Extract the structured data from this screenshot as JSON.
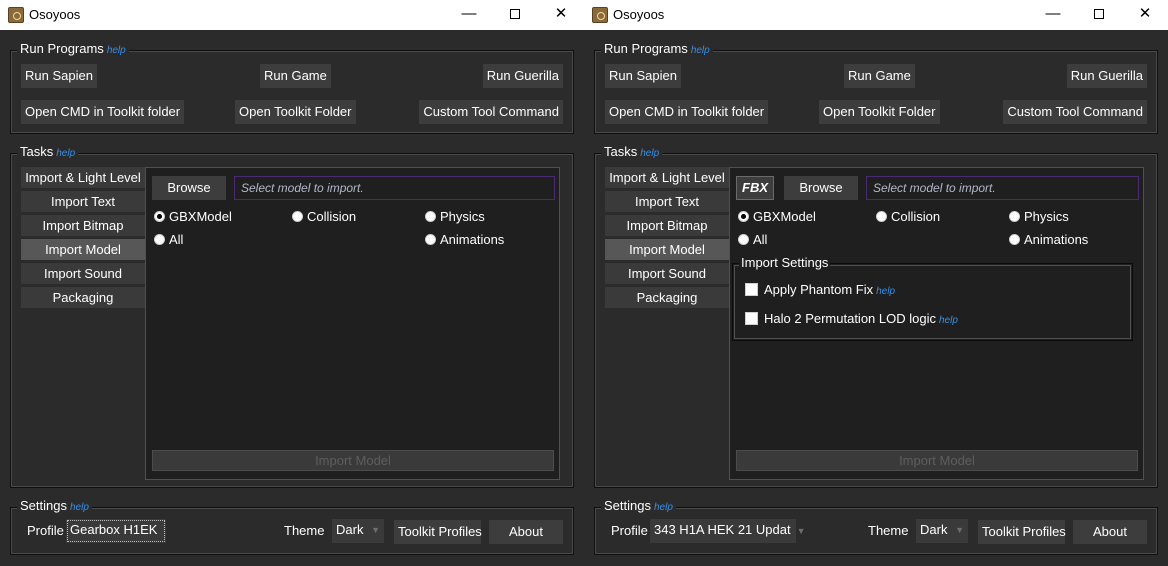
{
  "windows": [
    {
      "title": "Osoyoos",
      "run_programs": {
        "title": "Run Programs",
        "help": "help",
        "buttons": [
          "Run Sapien",
          "Run Game",
          "Run Guerilla",
          "Open CMD in Toolkit folder",
          "Open Toolkit Folder",
          "Custom Tool Command"
        ]
      },
      "tasks": {
        "title": "Tasks",
        "help": "help",
        "tabs": [
          "Import & Light Level",
          "Import Text",
          "Import Bitmap",
          "Import Model",
          "Import Sound",
          "Packaging"
        ],
        "active_tab": "Import Model",
        "browse_label": "Browse",
        "path_placeholder": "Select model to import.",
        "radios": [
          "GBXModel",
          "Collision",
          "Physics",
          "All",
          "Animations"
        ],
        "selected_radio": "GBXModel",
        "import_button": "Import Model"
      },
      "settings": {
        "title": "Settings",
        "help": "help",
        "profile_label": "Profile",
        "profile_value": "Gearbox H1EK",
        "theme_label": "Theme",
        "theme_value": "Dark",
        "toolkit_profiles_label": "Toolkit Profiles",
        "about_label": "About"
      }
    },
    {
      "title": "Osoyoos",
      "run_programs": {
        "title": "Run Programs",
        "help": "help",
        "buttons": [
          "Run Sapien",
          "Run Game",
          "Run Guerilla",
          "Open CMD in Toolkit folder",
          "Open Toolkit Folder",
          "Custom Tool Command"
        ]
      },
      "tasks": {
        "title": "Tasks",
        "help": "help",
        "tabs": [
          "Import & Light Level",
          "Import Text",
          "Import Bitmap",
          "Import Model",
          "Import Sound",
          "Packaging"
        ],
        "active_tab": "Import Model",
        "fbx_label": "FBX",
        "browse_label": "Browse",
        "path_placeholder": "Select model to import.",
        "radios": [
          "GBXModel",
          "Collision",
          "Physics",
          "All",
          "Animations"
        ],
        "selected_radio": "GBXModel",
        "import_settings": {
          "title": "Import Settings",
          "options": [
            {
              "label": "Apply Phantom Fix",
              "help": "help",
              "checked": false
            },
            {
              "label": "Halo 2 Permutation LOD logic",
              "help": "help",
              "checked": false
            }
          ]
        },
        "import_button": "Import Model"
      },
      "settings": {
        "title": "Settings",
        "help": "help",
        "profile_label": "Profile",
        "profile_value": "343 H1A HEK 21 Updat",
        "theme_label": "Theme",
        "theme_value": "Dark",
        "toolkit_profiles_label": "Toolkit Profiles",
        "about_label": "About"
      }
    }
  ],
  "colors": {
    "window_bg": "#2b2b2b",
    "panel_bg": "#1f1f1f",
    "button_bg": "#3d3d3d",
    "active_tab_bg": "#575757",
    "help_link": "#3a8ee6",
    "input_border": "#4a2a70"
  }
}
